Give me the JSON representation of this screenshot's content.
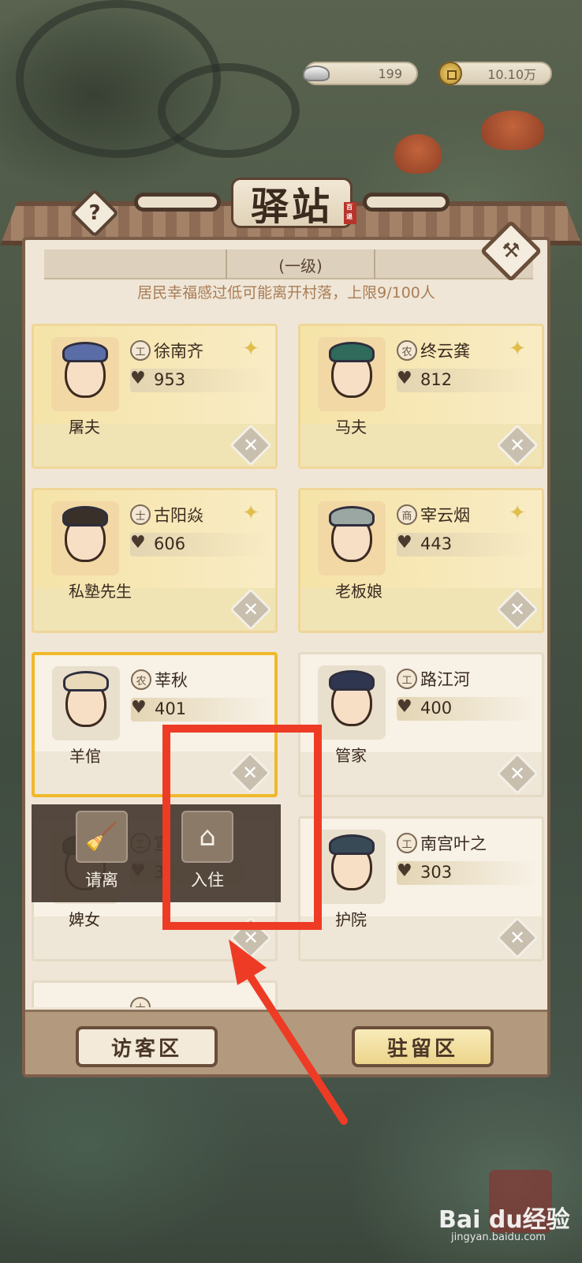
{
  "currency": {
    "silver": "199",
    "coins": "10.10万"
  },
  "header": {
    "title": "驿站",
    "stamp": "百退",
    "help": "?"
  },
  "panel": {
    "level": "(一级)",
    "info": "居民幸福感过低可能离开村落，上限9/100人"
  },
  "cards": [
    {
      "class": "工",
      "name": "徐南齐",
      "score": "953",
      "role": "屠夫"
    },
    {
      "class": "农",
      "name": "终云龚",
      "score": "812",
      "role": "马夫"
    },
    {
      "class": "士",
      "name": "古阳焱",
      "score": "606",
      "role": "私塾先生"
    },
    {
      "class": "商",
      "name": "宰云烟",
      "score": "443",
      "role": "老板娘"
    },
    {
      "class": "农",
      "name": "莘秋",
      "score": "401",
      "role": "羊倌"
    },
    {
      "class": "工",
      "name": "路江河",
      "score": "400",
      "role": "管家"
    },
    {
      "class": "工",
      "name": "宣",
      "score": "3",
      "role": "婢女"
    },
    {
      "class": "工",
      "name": "南宫叶之",
      "score": "303",
      "role": "护院"
    },
    {
      "class": "士",
      "name": "",
      "score": "",
      "role": ""
    }
  ],
  "popup": {
    "dismiss_label": "请离",
    "checkin_label": "入住"
  },
  "tabs": {
    "visitor": "访客区",
    "resident": "驻留区"
  },
  "watermark": {
    "brand": "Bai du经验",
    "url": "jingyan.baidu.com"
  },
  "colors": {
    "highlight": "#ee3b25",
    "gold_border": "#f0b82a"
  }
}
